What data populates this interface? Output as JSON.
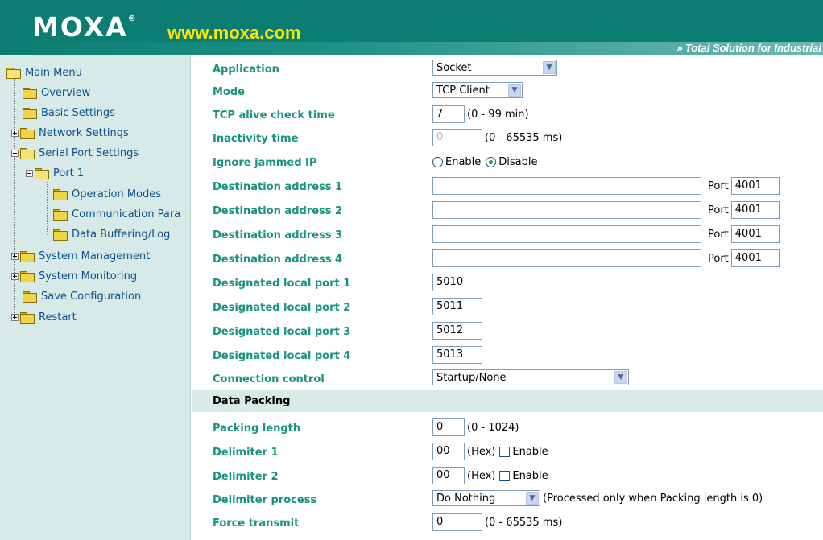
{
  "header": {
    "logo_text": "MOXA",
    "logo_reg": "®",
    "url": "www.moxa.com",
    "tagline_arrow": "»",
    "tagline": "Total Solution for Industrial"
  },
  "sidebar": {
    "items": [
      {
        "label": "Main Menu"
      },
      {
        "label": "Overview"
      },
      {
        "label": "Basic Settings"
      },
      {
        "label": "Network Settings"
      },
      {
        "label": "Serial Port Settings"
      },
      {
        "label": "Port 1"
      },
      {
        "label": "Operation Modes"
      },
      {
        "label": "Communication Para"
      },
      {
        "label": "Data Buffering/Log"
      },
      {
        "label": "System Management"
      },
      {
        "label": "System Monitoring"
      },
      {
        "label": "Save Configuration"
      },
      {
        "label": "Restart"
      }
    ]
  },
  "form": {
    "application": {
      "label": "Application",
      "value": "Socket"
    },
    "mode": {
      "label": "Mode",
      "value": "TCP Client"
    },
    "tcp_alive": {
      "label": "TCP alive check time",
      "value": "7",
      "hint": "(0 - 99 min)"
    },
    "inactivity": {
      "label": "Inactivity time",
      "value": "0",
      "hint": "(0 - 65535 ms)"
    },
    "ignore_jammed": {
      "label": "Ignore jammed IP",
      "option_enable": "Enable",
      "option_disable": "Disable",
      "selected": "Disable"
    },
    "dest1": {
      "label": "Destination address 1",
      "value": "",
      "port_label": "Port",
      "port": "4001"
    },
    "dest2": {
      "label": "Destination address 2",
      "value": "",
      "port_label": "Port",
      "port": "4001"
    },
    "dest3": {
      "label": "Destination address 3",
      "value": "",
      "port_label": "Port",
      "port": "4001"
    },
    "dest4": {
      "label": "Destination address 4",
      "value": "",
      "port_label": "Port",
      "port": "4001"
    },
    "local1": {
      "label": "Designated local port 1",
      "value": "5010"
    },
    "local2": {
      "label": "Designated local port 2",
      "value": "5011"
    },
    "local3": {
      "label": "Designated local port 3",
      "value": "5012"
    },
    "local4": {
      "label": "Designated local port 4",
      "value": "5013"
    },
    "connection_control": {
      "label": "Connection control",
      "value": "Startup/None"
    },
    "section_data_packing": "Data Packing",
    "packing_length": {
      "label": "Packing length",
      "value": "0",
      "hint": "(0 - 1024)"
    },
    "delimiter1": {
      "label": "Delimiter 1",
      "value": "00",
      "hint": "(Hex)",
      "checkbox_label": "Enable"
    },
    "delimiter2": {
      "label": "Delimiter 2",
      "value": "00",
      "hint": "(Hex)",
      "checkbox_label": "Enable"
    },
    "delimiter_process": {
      "label": "Delimiter process",
      "value": "Do Nothing",
      "hint": "(Processed only when Packing length is 0)"
    },
    "force_transmit": {
      "label": "Force transmit",
      "value": "0",
      "hint": "(0 - 65535 ms)"
    }
  },
  "colors": {
    "header_bg": "#0b7d72",
    "url_color": "#ffe600",
    "sidebar_bg": "#d8eae7",
    "label_color": "#17937f",
    "link_color": "#0b4f8c"
  }
}
